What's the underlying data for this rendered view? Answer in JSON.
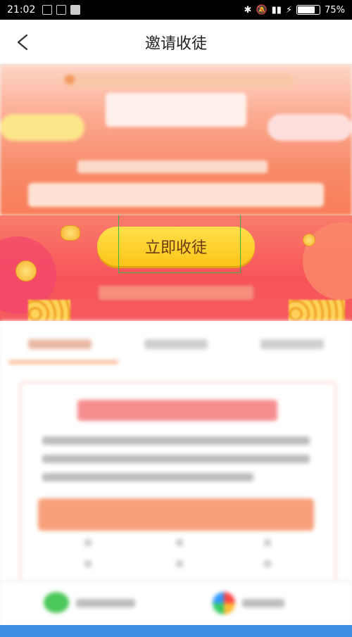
{
  "status_bar": {
    "time": "21:02",
    "battery": "75%"
  },
  "nav": {
    "title": "邀请收徒"
  },
  "banner": {
    "cta_label": "立即收徒"
  },
  "colors": {
    "accent": "#fcc418",
    "banner_red": "#f7545a",
    "focus_border": "#3fb24a",
    "system_nav": "#3e8ee4"
  }
}
